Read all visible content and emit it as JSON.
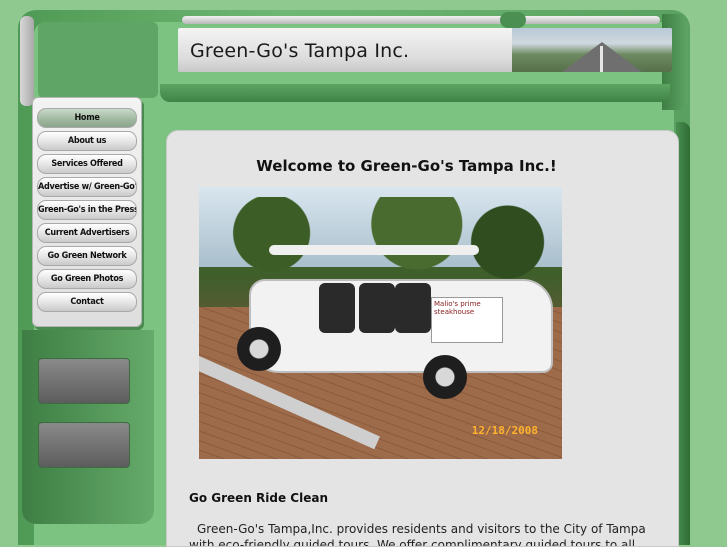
{
  "header": {
    "site_title": "Green-Go's Tampa Inc."
  },
  "nav": {
    "items": [
      {
        "label": "Home",
        "active": true
      },
      {
        "label": "About us"
      },
      {
        "label": "Services Offered"
      },
      {
        "label": "Advertise w/ Green-Go's"
      },
      {
        "label": "Green-Go's in the Press"
      },
      {
        "label": "Current Advertisers"
      },
      {
        "label": "Go Green Network"
      },
      {
        "label": "Go Green Photos"
      },
      {
        "label": "Contact"
      }
    ]
  },
  "main": {
    "welcome": "Welcome to Green-Go's Tampa Inc.!",
    "photo": {
      "sign_text": "Malio's prime steakhouse",
      "date_stamp": "12/18/2008"
    },
    "subheading": "Go Green Ride Clean",
    "intro": "Green-Go's Tampa,Inc. provides residents and visitors to the City of Tampa with eco-friendly guided tours. We offer complimentary guided tours to all special"
  },
  "colors": {
    "background": "#8fc98f",
    "frame_green": "#5fa565",
    "panel": "#e4e4e4",
    "date_stamp": "#ffb22e"
  }
}
